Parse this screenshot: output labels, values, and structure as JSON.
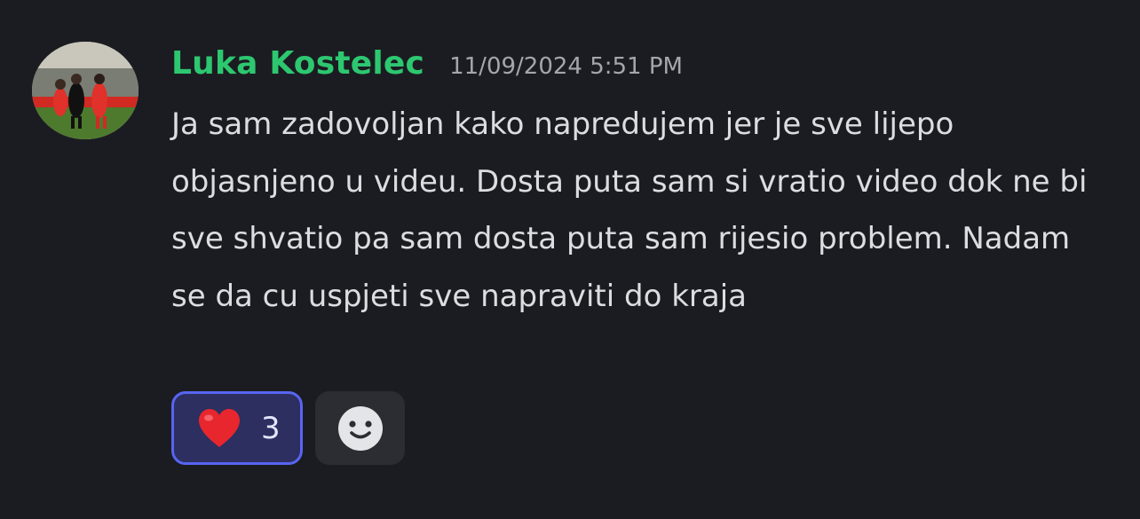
{
  "message": {
    "author": "Luka Kostelec",
    "timestamp": "11/09/2024 5:51 PM",
    "text": "Ja sam zadovoljan kako napredujem jer je sve lijepo objasnjeno u videu. Dosta puta sam si vratio video dok ne bi sve shvatio pa sam dosta puta sam rijesio problem. Nadam se da cu uspjeti sve napraviti do kraja",
    "reactions": [
      {
        "emoji": "heart",
        "count": "3",
        "selected": true
      }
    ],
    "add_reaction_icon": "smiley-icon"
  },
  "colors": {
    "background": "#1b1c21",
    "username": "#2dc770",
    "timestamp": "#a3a6ad",
    "text": "#dbdee1",
    "reaction_bg": "#2c2f60",
    "reaction_border": "#5865f2",
    "add_reaction_bg": "#2b2d33"
  }
}
